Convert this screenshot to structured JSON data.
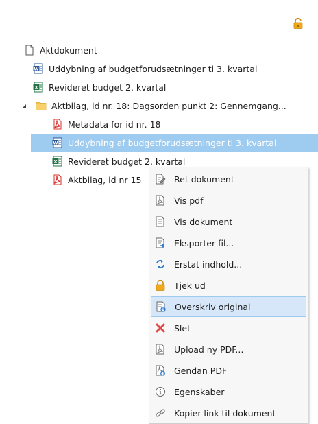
{
  "toolbar": {
    "lock_icon": "padlock-open-icon"
  },
  "tree": {
    "items": [
      {
        "label": "Aktdokument",
        "icon": "blank-document-icon"
      },
      {
        "label": "Uddybning af budgetforudsætninger ti 3. kvartal",
        "icon": "word-document-icon"
      },
      {
        "label": "Revideret budget 2. kvartal",
        "icon": "excel-document-icon"
      },
      {
        "label": "Aktbilag, id nr. 18: Dagsorden punkt 2: Gennemgang...",
        "icon": "folder-icon",
        "expanded": true
      },
      {
        "label": "Metadata for id nr. 18",
        "icon": "pdf-document-icon"
      },
      {
        "label": "Uddybning af budgetforudsætninger ti 3. kvartal",
        "icon": "word-document-icon",
        "selected": true
      },
      {
        "label": "Revideret budget 2. kvartal",
        "icon": "excel-document-icon"
      },
      {
        "label": "Aktbilag, id nr 15",
        "icon": "pdf-document-icon"
      }
    ]
  },
  "context_menu": {
    "items": [
      {
        "label": "Ret dokument",
        "icon": "edit-document-icon"
      },
      {
        "label": "Vis pdf",
        "icon": "pdf-outline-icon"
      },
      {
        "label": "Vis dokument",
        "icon": "view-document-icon"
      },
      {
        "label": "Eksporter fil...",
        "icon": "export-file-icon"
      },
      {
        "label": "Erstat indhold...",
        "icon": "replace-content-icon"
      },
      {
        "label": "Tjek ud",
        "icon": "checkout-lock-icon"
      },
      {
        "label": "Overskriv original",
        "icon": "overwrite-original-icon",
        "hover": true
      },
      {
        "label": "Slet",
        "icon": "delete-x-icon"
      },
      {
        "label": "Upload ny PDF...",
        "icon": "upload-pdf-icon"
      },
      {
        "label": "Gendan PDF",
        "icon": "restore-pdf-icon"
      },
      {
        "label": "Egenskaber",
        "icon": "info-icon"
      },
      {
        "label": "Kopier link til dokument",
        "icon": "link-icon"
      }
    ]
  },
  "colors": {
    "selected_row": "#9ecbf0",
    "menu_hover": "#d5e7f8",
    "word_blue": "#2b5797",
    "excel_green": "#217346",
    "pdf_red": "#d9302c",
    "folder_yellow": "#f2c24e",
    "lock_orange": "#e8a21c"
  }
}
